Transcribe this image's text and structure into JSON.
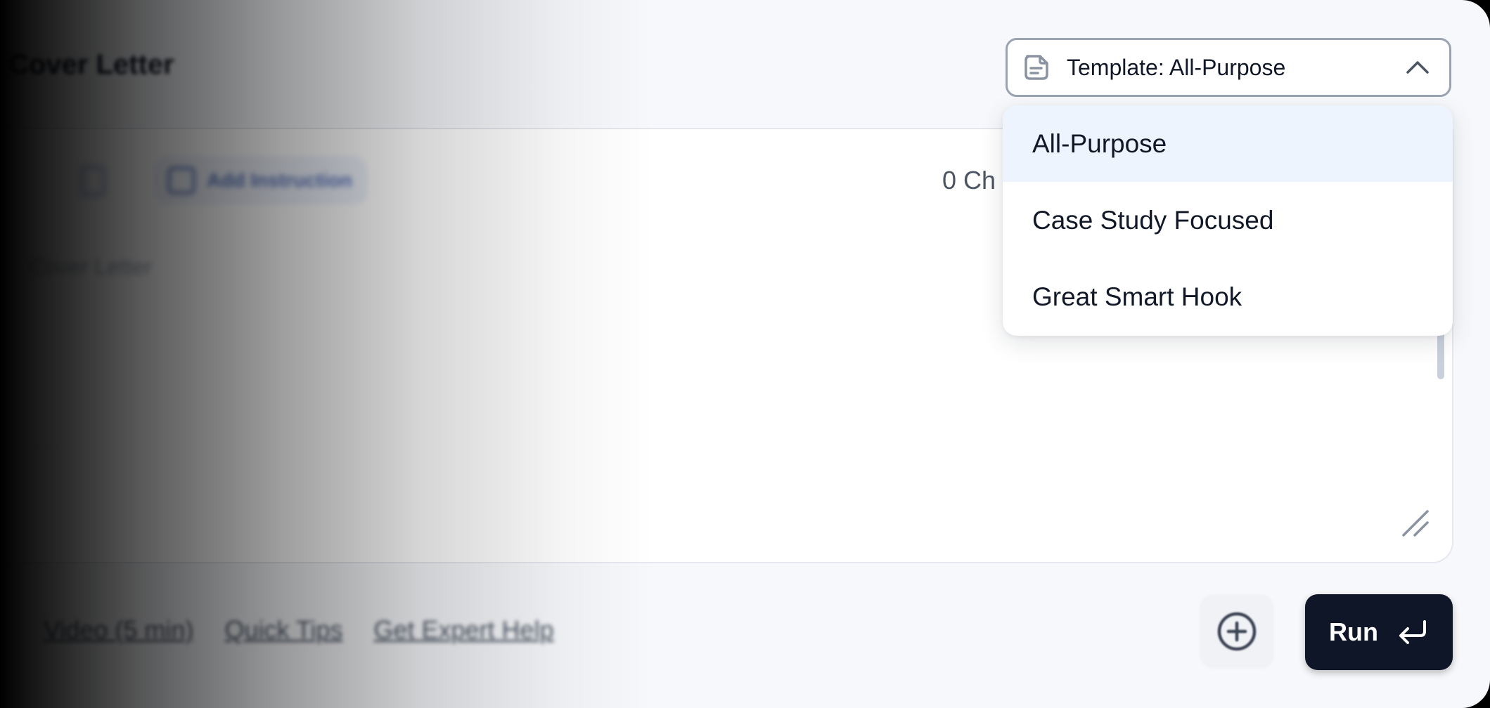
{
  "header": {
    "title": "Cover Letter"
  },
  "template_select": {
    "label": "Template: All-Purpose",
    "icon": "document-icon",
    "toggle_icon": "chevron-up-icon",
    "expanded": true,
    "selected": "All-Purpose"
  },
  "template_options": [
    {
      "label": "All-Purpose"
    },
    {
      "label": "Case Study Focused"
    },
    {
      "label": "Great Smart Hook"
    }
  ],
  "toolbar": {
    "add_instruction_label": "Add Instruction",
    "char_count": "0 Ch"
  },
  "editor": {
    "placeholder": "Cover Letter"
  },
  "footer": {
    "links": [
      {
        "label": "Video (5 min)"
      },
      {
        "label": "Quick Tips"
      },
      {
        "label": "Get Expert Help"
      }
    ],
    "add_icon": "plus-circle-icon",
    "run_label": "Run",
    "run_icon": "enter-return-icon"
  },
  "colors": {
    "run_button_bg": "#0e1628",
    "selected_option_bg": "#eef4fd",
    "select_border": "#9aa3b2"
  }
}
